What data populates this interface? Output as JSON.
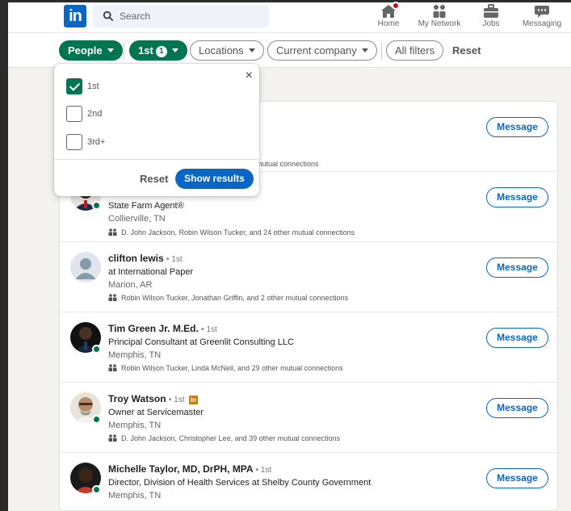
{
  "nav": {
    "search_placeholder": "Search",
    "items": [
      {
        "label": "Home",
        "icon": "home-icon"
      },
      {
        "label": "My Network",
        "icon": "network-icon"
      },
      {
        "label": "Jobs",
        "icon": "briefcase-icon"
      },
      {
        "label": "Messaging",
        "icon": "messaging-icon"
      }
    ]
  },
  "filters": {
    "people": "People",
    "connections": "1st",
    "connections_count": "1",
    "locations": "Locations",
    "current_company": "Current company",
    "all_filters": "All filters",
    "reset": "Reset"
  },
  "dropdown": {
    "options": [
      {
        "label": "1st",
        "checked": true
      },
      {
        "label": "2nd",
        "checked": false
      },
      {
        "label": "3rd+",
        "checked": false
      }
    ],
    "reset": "Reset",
    "show_results": "Show results",
    "close": "×"
  },
  "results": [
    {
      "name": "",
      "degree": "",
      "headline": "",
      "location": "",
      "mutual_visible": "ther mutual connections",
      "message": "Message",
      "avatar_color": "#ffffff"
    },
    {
      "name": "",
      "degree": "",
      "headline": "State Farm Agent®",
      "location": "Collierville, TN",
      "mutual": "D. John Jackson, Robin Wilson Tucker, and 24 other mutual connections",
      "message": "Message",
      "avatar_color": "#3b2a24"
    },
    {
      "name": "clifton lewis",
      "degree": "• 1st",
      "headline": "at International Paper",
      "location": "Marion, AR",
      "mutual": "Robin Wilson Tucker, Jonathan Griffin, and 2 other mutual connections",
      "message": "Message",
      "avatar_color": "#a9b4c2"
    },
    {
      "name": "Tim Green Jr. M.Ed.",
      "degree": "• 1st",
      "headline": "Principal Consultant at Greenlit Consulting LLC",
      "location": "Memphis, TN",
      "mutual": "Robin Wilson Tucker, Linda McNeil, and 29 other mutual connections",
      "message": "Message",
      "avatar_color": "#2c2420"
    },
    {
      "name": "Troy Watson",
      "degree": "• 1st",
      "headline": "Owner at Servicemaster",
      "location": "Memphis, TN",
      "mutual": "D. John Jackson, Christopher Lee, and 39 other mutual connections",
      "message": "Message",
      "avatar_color": "#b78a6a"
    },
    {
      "name": "Michelle Taylor, MD, DrPH, MPA",
      "degree": "• 1st",
      "headline": "Director, Division of Health Services at Shelby County Government",
      "location": "Memphis, TN",
      "message": "Message",
      "avatar_color": "#3a2318"
    }
  ]
}
